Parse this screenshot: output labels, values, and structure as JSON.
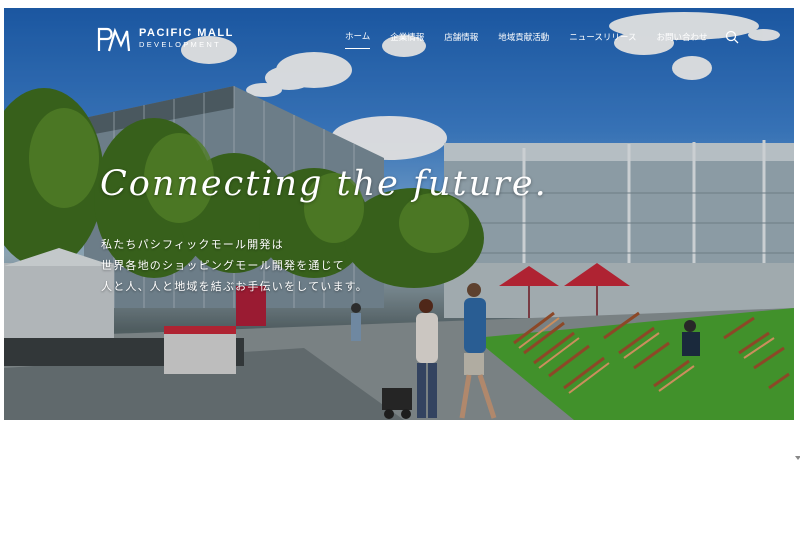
{
  "brand": {
    "name_line1": "PACIFIC MALL",
    "name_line2": "DEVELOPMENT"
  },
  "nav": {
    "items": [
      {
        "label": "ホーム",
        "active": true
      },
      {
        "label": "企業情報",
        "active": false
      },
      {
        "label": "店舗情報",
        "active": false
      },
      {
        "label": "地域貢献活動",
        "active": false
      },
      {
        "label": "ニュースリリース",
        "active": false
      },
      {
        "label": "お問い合わせ",
        "active": false
      }
    ],
    "search_icon": "search-icon"
  },
  "hero": {
    "headline": "Connecting the future.",
    "tagline": [
      "私たちパシフィックモール開発は",
      "世界各地のショッピングモール開発を通じて",
      "人と人、人と地域を結ぶお手伝いをしています。"
    ]
  },
  "colors": {
    "text": "#ffffff",
    "sky": "#2a6fc2",
    "umbrella": "#c8283a",
    "lawn": "#4aa532"
  }
}
